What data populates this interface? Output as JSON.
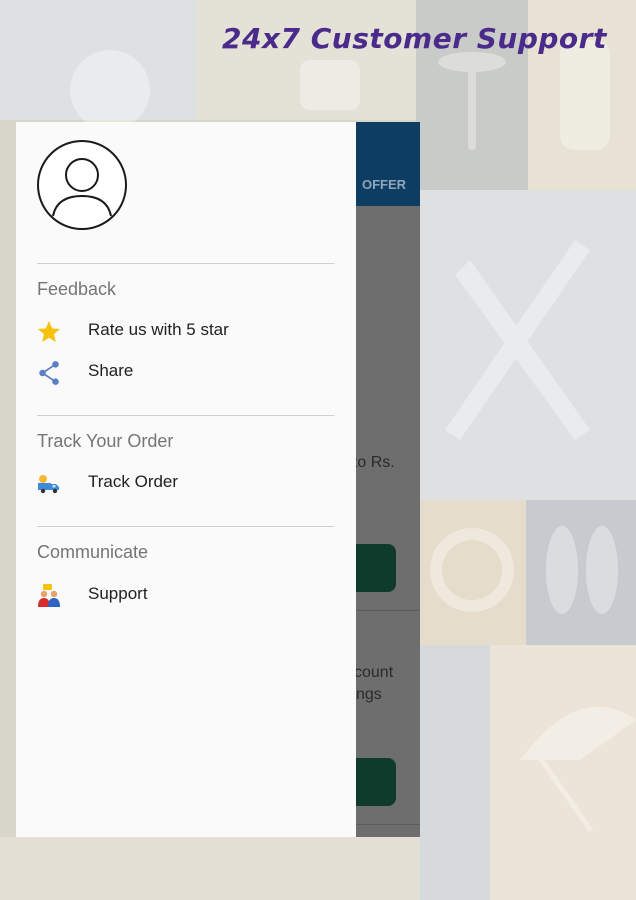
{
  "promo": {
    "headline": "24x7 Customer Support"
  },
  "app_screen": {
    "tab_offer": "OFFER",
    "card1_text": "pto Rs.",
    "card2_line1": "count",
    "card2_line2": "ngs"
  },
  "drawer": {
    "sections": [
      {
        "title": "Feedback",
        "items": [
          {
            "label": "Rate us with 5 star",
            "icon": "star-icon"
          },
          {
            "label": "Share",
            "icon": "share-icon"
          }
        ]
      },
      {
        "title": "Track Your Order",
        "items": [
          {
            "label": "Track Order",
            "icon": "delivery-truck-icon"
          }
        ]
      },
      {
        "title": "Communicate",
        "items": [
          {
            "label": "Support",
            "icon": "support-people-icon"
          }
        ]
      }
    ]
  },
  "colors": {
    "appbar": "#0d3d63",
    "headline": "#4a2a8a",
    "star": "#f4c20d",
    "share": "#5b7fc4"
  }
}
